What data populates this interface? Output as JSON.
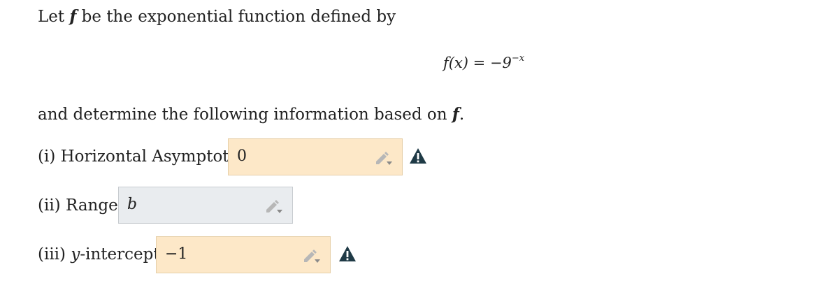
{
  "intro": {
    "prefix": "Let ",
    "fvar": "f",
    "suffix": " be the exponential function defined by"
  },
  "formula": {
    "lhs": "f(x) = −9",
    "exponent": "−x"
  },
  "instruction": {
    "prefix": "and determine the following information based on ",
    "fvar": "f",
    "suffix": "."
  },
  "questions": [
    {
      "label": "(i) Horizontal Asymptote:",
      "value": "0",
      "status": "warning"
    },
    {
      "label": "(ii) Range:",
      "value": "b",
      "status": "none"
    },
    {
      "label_prefix": "(iii) ",
      "label_var": "y",
      "label_suffix": "-intercept:",
      "value": "−1",
      "status": "warning"
    }
  ],
  "icons": {
    "edit": "pencil-dropdown-icon",
    "warning": "warning-triangle-icon"
  },
  "colors": {
    "warning_field": "#fde8c8",
    "neutral_field": "#e9ecef",
    "warning_icon": "#1f3a46"
  }
}
